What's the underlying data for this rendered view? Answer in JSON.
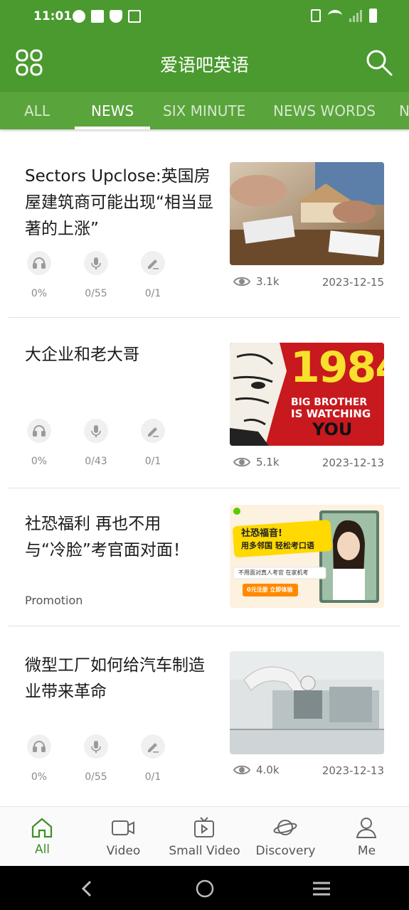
{
  "status_bar": {
    "time": "11:01"
  },
  "app_bar": {
    "title": "爱语吧英语",
    "menu_icon": "grid-menu-icon",
    "search_icon": "search-icon"
  },
  "tabs": [
    {
      "label": "ALL",
      "active": false
    },
    {
      "label": "NEWS",
      "active": true
    },
    {
      "label": "SIX MINUTE",
      "active": false
    },
    {
      "label": "NEWS WORDS",
      "active": false
    },
    {
      "label": "N",
      "active": false
    }
  ],
  "articles": [
    {
      "title": "Sectors Upclose:英国房屋建筑商可能出现“相当显著的上涨”",
      "stats": [
        "0%",
        "0/55",
        "0/1"
      ],
      "views": "3.1k",
      "date": "2023-12-15"
    },
    {
      "title": "大企业和老大哥",
      "stats": [
        "0%",
        "0/43",
        "0/1"
      ],
      "views": "5.1k",
      "date": "2023-12-13",
      "thumb_text": {
        "big": "1984",
        "line1": "BIG BROTHER",
        "line2": "IS WATCHING",
        "line3": "YOU"
      }
    },
    {
      "title": "社恐福利 再也不用与“冷脸”考官面对面！",
      "label": "Promotion",
      "thumb_text": {
        "headline1": "社恐福音!",
        "headline2": "用多邻国 轻松考口语",
        "sub": "不用面对真人考官 在家机考",
        "cta": "0元注册 立即体验"
      }
    },
    {
      "title": "微型工厂如何给汽车制造业带来革命",
      "stats": [
        "0%",
        "0/55",
        "0/1"
      ],
      "views": "4.0k",
      "date": "2023-12-13"
    }
  ],
  "bottom_nav": [
    {
      "label": "All",
      "icon": "home-icon",
      "active": true
    },
    {
      "label": "Video",
      "icon": "video-camera-icon",
      "active": false
    },
    {
      "label": "Small Video",
      "icon": "tv-icon",
      "active": false
    },
    {
      "label": "Discovery",
      "icon": "planet-icon",
      "active": false
    },
    {
      "label": "Me",
      "icon": "user-icon",
      "active": false
    }
  ],
  "colors": {
    "primary": "#4a9a2f",
    "tab_bg": "#5aa43c",
    "active_nav": "#3f8f26"
  }
}
